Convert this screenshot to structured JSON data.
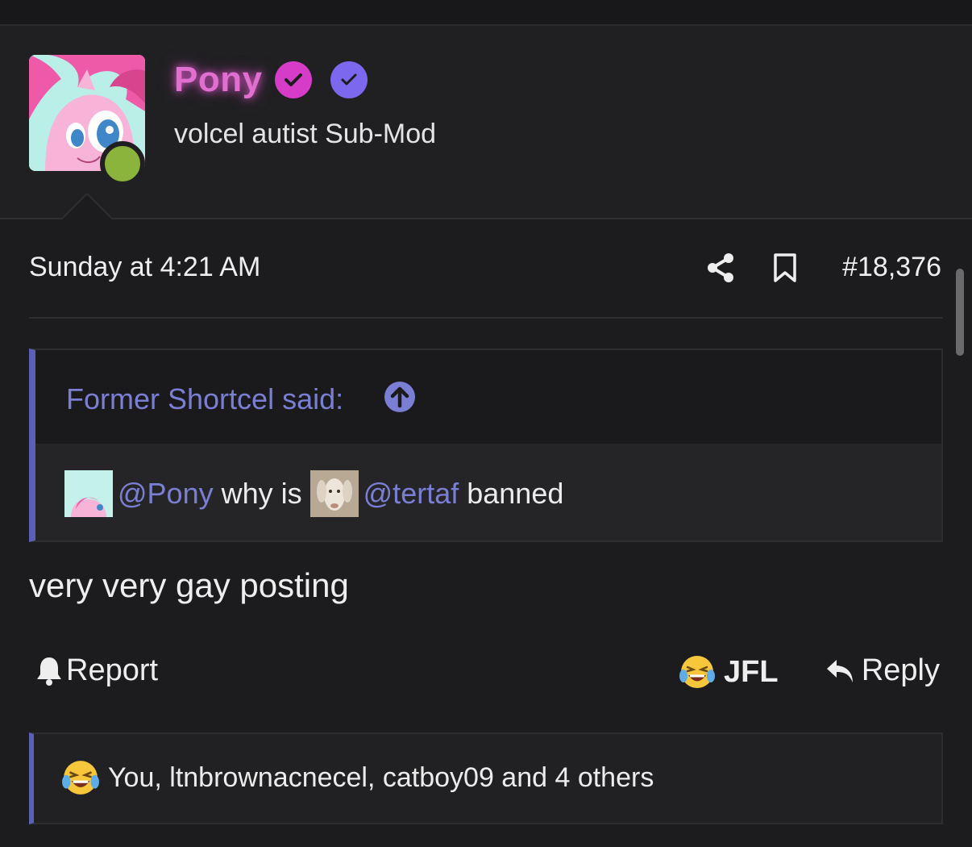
{
  "colors": {
    "background": "#1c1c1e",
    "panel": "#202022",
    "username": "#e06fd0",
    "mention": "#7a7fd3",
    "quote_border": "#5b5fb8",
    "online": "#8ab43c",
    "badge_pink": "#d63cc8",
    "badge_purple": "#7b68ee"
  },
  "user": {
    "name": "Pony",
    "title": "volcel autist Sub-Mod",
    "avatar_icon": "pony-avatar",
    "status": "online",
    "badges": [
      "verified-pink-check-icon",
      "verified-purple-check-icon"
    ]
  },
  "post": {
    "time": "Sunday at 4:21 AM",
    "number": "#18,376",
    "share_icon": "share-icon",
    "bookmark_icon": "bookmark-icon",
    "body": "very very gay posting"
  },
  "quote": {
    "header": "Former Shortcel said:",
    "mention_1": "@Pony",
    "middle_text": "why is",
    "mention_2": "@tertaf",
    "end_text": "banned"
  },
  "actions": {
    "report_label": "Report",
    "reaction_label": "JFL",
    "reply_label": "Reply"
  },
  "reactions": {
    "summary": "You, ltnbrownacnecel, catboy09 and 4 others"
  }
}
